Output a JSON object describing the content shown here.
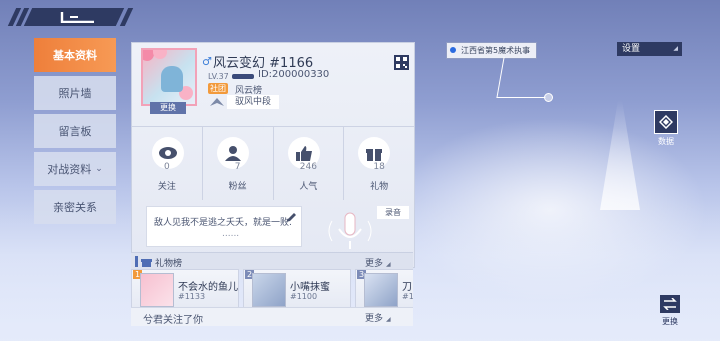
{
  "tabs": [
    {
      "label": "基本资料",
      "active": true
    },
    {
      "label": "照片墙"
    },
    {
      "label": "留言板"
    },
    {
      "label": "对战资料",
      "chevron": true
    },
    {
      "label": "亲密关系"
    }
  ],
  "profile": {
    "gender_icon": "male-icon",
    "name": "风云变幻",
    "id_tag": "#1166",
    "level": "LV.37",
    "uid": "ID:200000330",
    "group_tag": "社团",
    "group_name": "风云榜",
    "rank": "驭风中段",
    "change_avatar": "更换"
  },
  "stats": [
    {
      "icon": "eye-icon",
      "value": "0",
      "label": "关注"
    },
    {
      "icon": "fans-icon",
      "value": "7",
      "label": "粉丝"
    },
    {
      "icon": "thumbs-up-icon",
      "value": "246",
      "label": "人气"
    },
    {
      "icon": "gift-icon",
      "value": "18",
      "label": "礼物"
    }
  ],
  "signature": {
    "line1": "敌人见我不是逃之夭夭，就是一败.",
    "line2": "......"
  },
  "record_label": "录音",
  "gift_board": {
    "title": "礼物榜",
    "more": "更多",
    "items": [
      {
        "rank": "1",
        "name": "不会水的鱼儿",
        "value": "#1133"
      },
      {
        "rank": "2",
        "name": "小嘴抹蜜",
        "value": "#1100"
      },
      {
        "rank": "3",
        "name": "刀",
        "value": "#1"
      }
    ]
  },
  "follow_notice": {
    "text": "兮君关注了你",
    "more": "更多"
  },
  "map_label": "江西省第5魔术执事",
  "settings_label": "设置",
  "data_label": "数据",
  "swap_label": "更换",
  "colors": {
    "accent": "#ee7f3b",
    "navy": "#2e3a62",
    "group_tag": "#f29a3c"
  }
}
